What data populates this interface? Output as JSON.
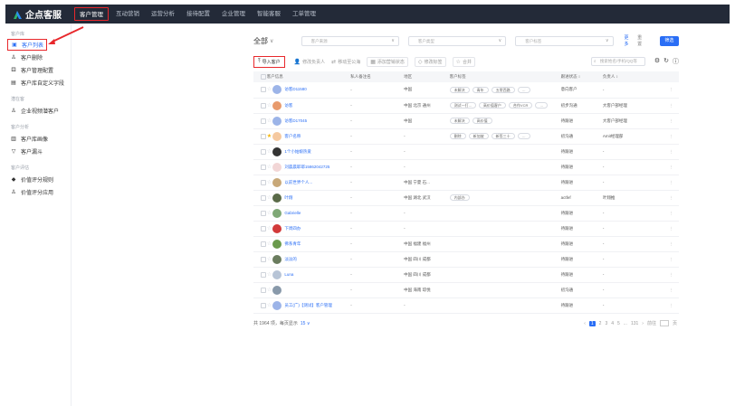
{
  "app": {
    "title": "企点客服"
  },
  "topnav": [
    {
      "label": "客户管理",
      "active": true
    },
    {
      "label": "互动营销"
    },
    {
      "label": "运营分析"
    },
    {
      "label": "接待配置"
    },
    {
      "label": "企业管理"
    },
    {
      "label": "智能客服"
    },
    {
      "label": "工单管理"
    }
  ],
  "sidebar": {
    "groups": [
      {
        "title": "客户库",
        "items": [
          {
            "label": "客户列表",
            "icon": "customer-list-icon",
            "active": true
          },
          {
            "label": "客户删除",
            "icon": "customer-delete-icon"
          },
          {
            "label": "客户管理配置",
            "icon": "config-icon"
          },
          {
            "label": "客户库自定义字段",
            "icon": "custom-field-icon"
          }
        ]
      },
      {
        "title": "潜在客",
        "items": [
          {
            "label": "企业视频潜客户",
            "icon": "video-lead-icon"
          }
        ]
      },
      {
        "title": "客户分析",
        "items": [
          {
            "label": "客户库画像",
            "icon": "portrait-icon"
          },
          {
            "label": "客户漏斗",
            "icon": "funnel-icon"
          }
        ]
      },
      {
        "title": "客户评估",
        "items": [
          {
            "label": "价值评分规则",
            "icon": "diamond-icon"
          },
          {
            "label": "价值评分应用",
            "icon": "apply-icon"
          }
        ]
      }
    ]
  },
  "filters": {
    "all_label": "全部",
    "selects": [
      "客户来源",
      "客户类型",
      "客户标签"
    ],
    "more_label": "更多",
    "reset_label": "重置",
    "search_label": "筛选"
  },
  "toolbar": {
    "import_label": "导入客户",
    "buttons": [
      "修改负责人",
      "移动至公海",
      "添加营销状态",
      "修改标签",
      "合并"
    ],
    "search_placeholder": "搜索姓名/手机/QQ等"
  },
  "table": {
    "headers": [
      "客户信息",
      "私人备注名",
      "地区",
      "客户标签",
      "跟进状态 ↕",
      "负责人 ↕"
    ],
    "rows": [
      {
        "name": "访客D11580",
        "note": "-",
        "region": "中国",
        "tags": [
          "未解决",
          "青年",
          "五常西路"
        ],
        "status": "意向客户",
        "owner": "-",
        "avatar": "#9cb4e8"
      },
      {
        "name": "访客",
        "note": "-",
        "region": "中国 北京 通州",
        "tags": [
          "测试一打...",
          "高价值客户",
          "合作VCR"
        ],
        "status": "初步沟通",
        "owner": "大客户部经理",
        "avatar": "#e89a6c"
      },
      {
        "name": "访客D17045",
        "note": "-",
        "region": "中国",
        "tags": [
          "未解决",
          "高价值"
        ],
        "status": "待跟进",
        "owner": "大客户部经理",
        "avatar": "#9cb4e8"
      },
      {
        "name": "客户名称",
        "note": "-",
        "region": "-",
        "tags": [
          "删除",
          "新加坡",
          "新签三十"
        ],
        "status": "初沟通",
        "owner": "Amit经理部",
        "avatar": "#f5c9a0",
        "starred": true
      },
      {
        "name": "1个小姑娘热爱",
        "note": "-",
        "region": "-",
        "tags": [],
        "status": "待跟进",
        "owner": "-",
        "avatar": "#333333"
      },
      {
        "name": "刘晨晨耶耶15862042725",
        "note": "-",
        "region": "-",
        "tags": [],
        "status": "待跟进",
        "owner": "-",
        "avatar": "#f2d6d6"
      },
      {
        "name": "以前世界个人...",
        "note": "-",
        "region": "中国 宁夏 石...",
        "tags": [],
        "status": "待跟进",
        "owner": "-",
        "avatar": "#c8a878"
      },
      {
        "name": "叶翔",
        "note": "-",
        "region": "中国 湖北 武汉",
        "tags": [
          "内部办"
        ],
        "status": "actfef",
        "owner": "叶翔推",
        "avatar": "#5a6a48"
      },
      {
        "name": "Gabrielle",
        "note": "-",
        "region": "-",
        "tags": [],
        "status": "待跟进",
        "owner": "-",
        "avatar": "#7fa876"
      },
      {
        "name": "下周四办",
        "note": "-",
        "region": "-",
        "tags": [],
        "status": "待跟进",
        "owner": "-",
        "avatar": "#d23a3a"
      },
      {
        "name": "佛系青年",
        "note": "-",
        "region": "中国 福建 福州",
        "tags": [],
        "status": "待跟进",
        "owner": "-",
        "avatar": "#6a9a4c"
      },
      {
        "name": "淡淡的",
        "note": "-",
        "region": "中国 四川 成都",
        "tags": [],
        "status": "待跟进",
        "owner": "-",
        "avatar": "#6a7c5e"
      },
      {
        "name": "Luna",
        "note": "-",
        "region": "中国 四川 成都",
        "tags": [],
        "status": "待跟进",
        "owner": "-",
        "avatar": "#b7c4d6"
      },
      {
        "name": "",
        "note": "-",
        "region": "中国 海南 琼悦",
        "tags": [],
        "status": "初沟通",
        "owner": "-",
        "avatar": "#8899aa"
      },
      {
        "name": "员工(广)【测试】客户管理",
        "note": "-",
        "region": "-",
        "tags": [],
        "status": "待跟进",
        "owner": "-",
        "avatar": "#9cb4e8"
      }
    ]
  },
  "footer": {
    "total_label": "共 1964 项，每页显示",
    "page_size": "15",
    "pages": [
      "1",
      "2",
      "3",
      "4",
      "5",
      "...",
      "131"
    ],
    "goto_label": "前往",
    "page_suffix": "页"
  }
}
